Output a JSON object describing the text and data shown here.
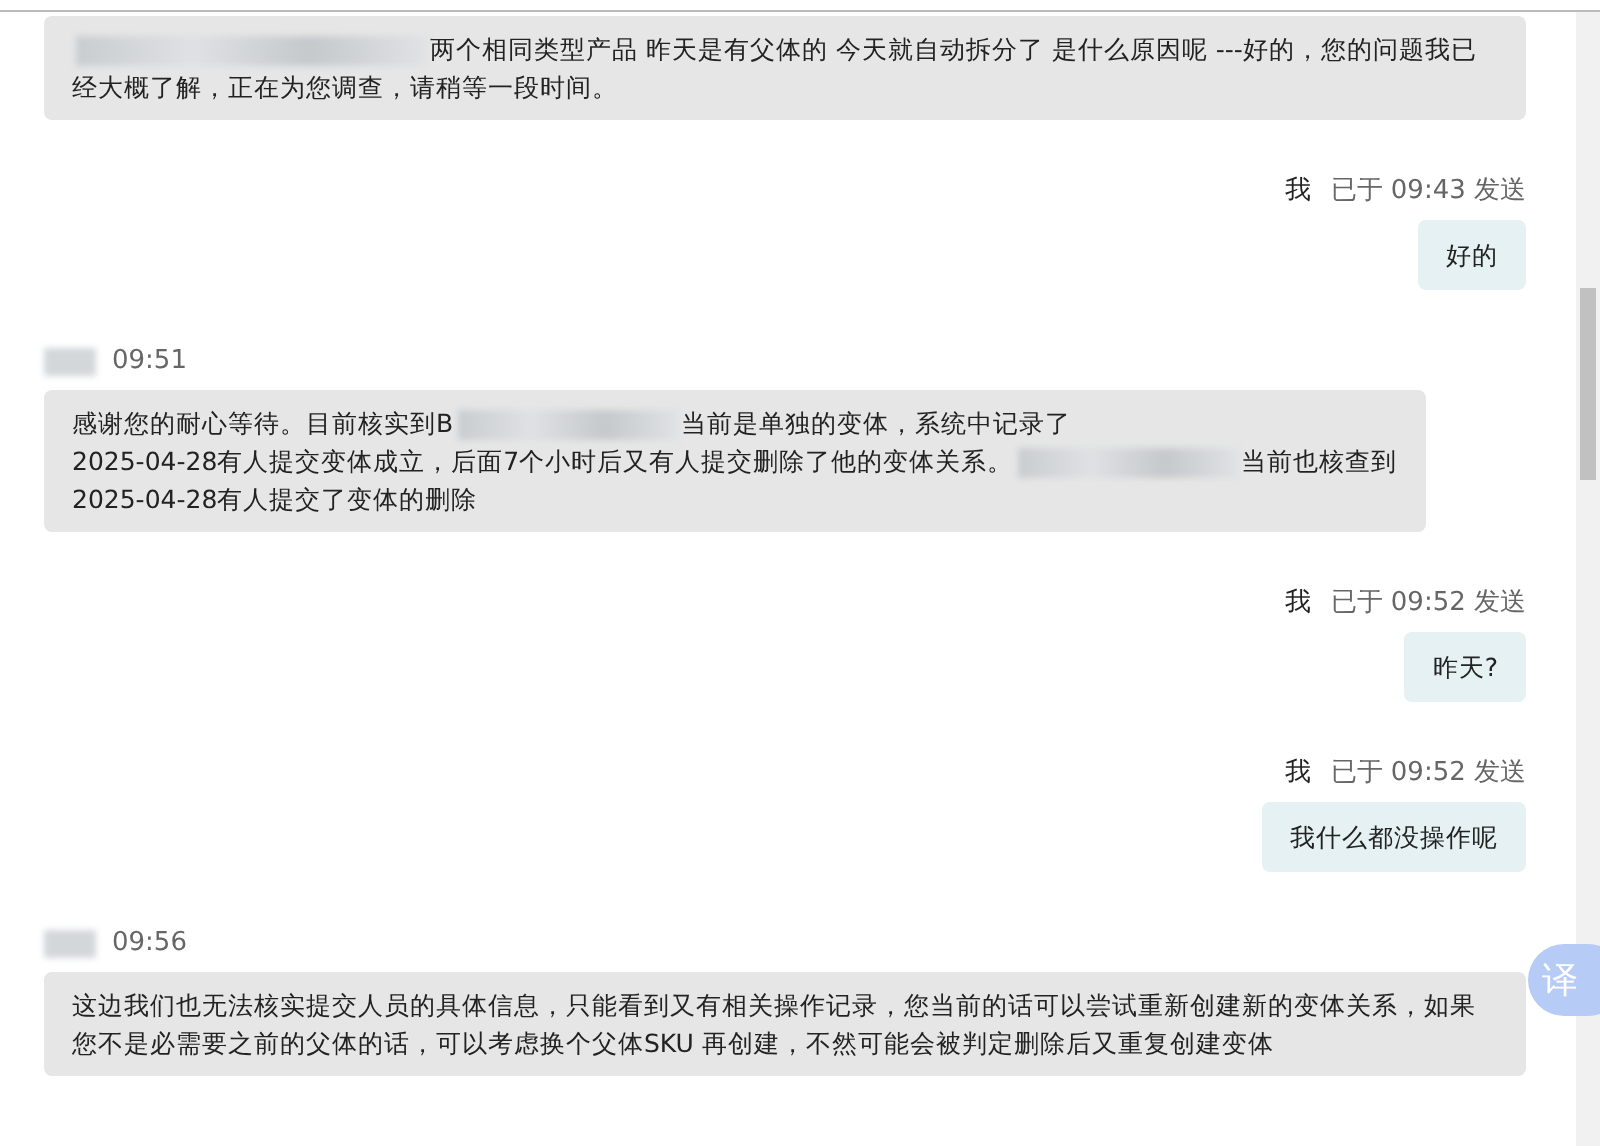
{
  "messages": [
    {
      "kind": "incoming",
      "segments": [
        {
          "kind": "redacted"
        },
        {
          "kind": "text",
          "text": "两个相同类型产品 昨天是有父体的 今天就自动拆分了 是什么原因呢 ---好的，您的问题我已经大概了解，正在为您调查，请稍等一段时间。"
        }
      ]
    },
    {
      "kind": "outgoing",
      "sender": "我",
      "time": "已于 09:43 发送",
      "segments": [
        {
          "kind": "text",
          "text": "好的"
        }
      ]
    },
    {
      "kind": "incoming",
      "sender_redacted": true,
      "time": "09:51",
      "segments": [
        {
          "kind": "text",
          "text": "感谢您的耐心等待。目前核实到B"
        },
        {
          "kind": "redacted"
        },
        {
          "kind": "text",
          "text": "当前是单独的变体，系统中记录了"
        },
        {
          "kind": "break"
        },
        {
          "kind": "text",
          "text": "2025-04-28有人提交变体成立，后面7个小时后又有人提交删除了他的变体关系。"
        },
        {
          "kind": "redacted"
        },
        {
          "kind": "text",
          "text": "当前也核查到"
        },
        {
          "kind": "break"
        },
        {
          "kind": "text",
          "text": "2025-04-28有人提交了变体的删除"
        }
      ]
    },
    {
      "kind": "outgoing",
      "sender": "我",
      "time": "已于 09:52 发送",
      "segments": [
        {
          "kind": "text",
          "text": "昨天?"
        }
      ]
    },
    {
      "kind": "outgoing",
      "sender": "我",
      "time": "已于 09:52 发送",
      "segments": [
        {
          "kind": "text",
          "text": "我什么都没操作呢"
        }
      ]
    },
    {
      "kind": "incoming",
      "sender_redacted": true,
      "time": "09:56",
      "segments": [
        {
          "kind": "text",
          "text": "这边我们也无法核实提交人员的具体信息，只能看到又有相关操作记录，您当前的话可以尝试重新创建新的变体关系，如果您不是必需要之前的父体的话，可以考虑换个父体SKU 再创建，不然可能会被判定删除后又重复创建变体"
        }
      ]
    }
  ],
  "translate_button": {
    "label": "译"
  }
}
